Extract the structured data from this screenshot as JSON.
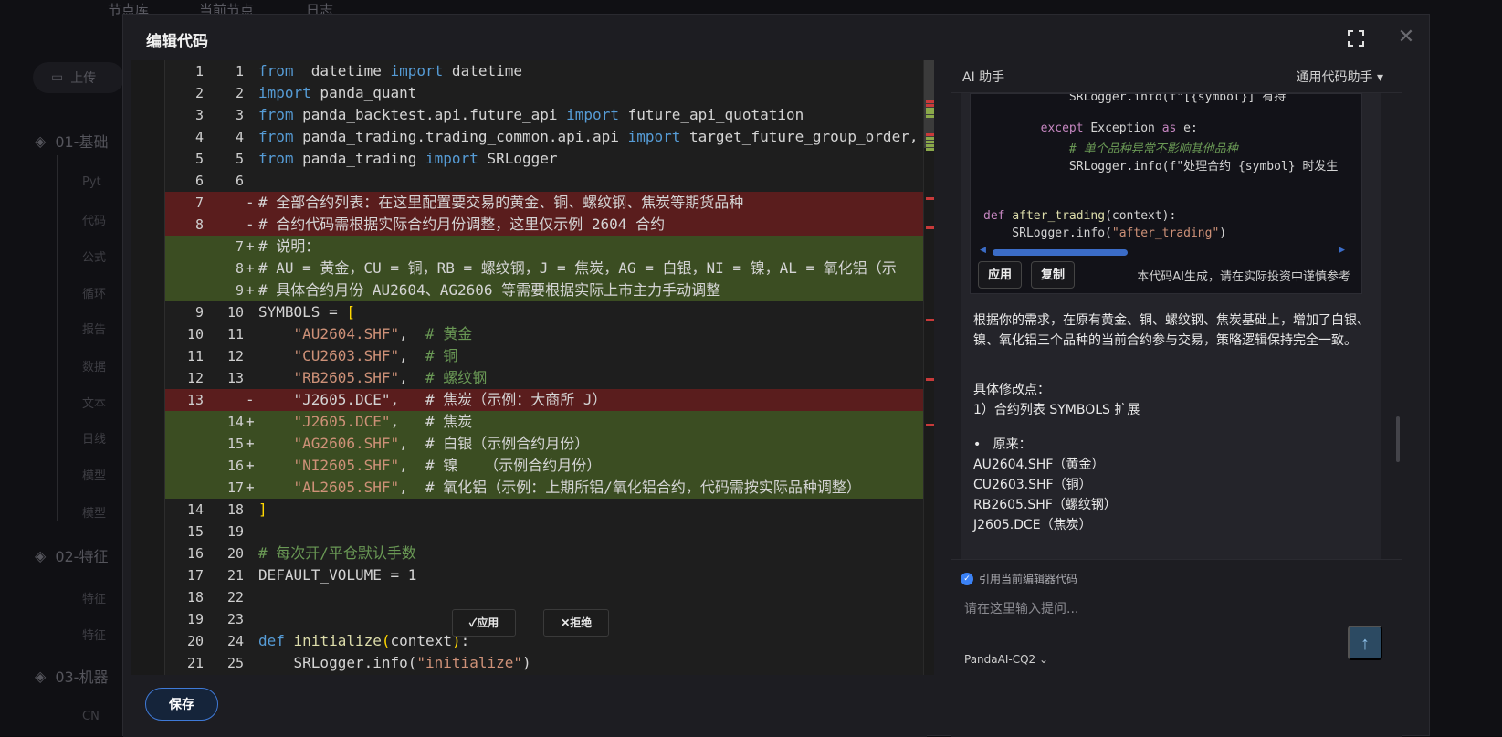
{
  "background": {
    "tabs": [
      "节点库",
      "当前节点",
      "日志"
    ],
    "upload_label": "上传",
    "groups": [
      "01-基础",
      "02-特征",
      "03-机器"
    ],
    "leaves": [
      "Pyt",
      "代码",
      "公式",
      "循环",
      "报告",
      "数据",
      "文本",
      "日线",
      "模型",
      "模型",
      "特征",
      "特征",
      "CN"
    ]
  },
  "modal": {
    "title": "编辑代码",
    "save_label": "保存"
  },
  "editor": {
    "lines": [
      {
        "o": "1",
        "n": "1",
        "s": "",
        "t": "n",
        "code": [
          [
            "kw",
            "from"
          ],
          [
            "",
            "  datetime "
          ],
          [
            "kw",
            "import"
          ],
          [
            "",
            " datetime"
          ]
        ]
      },
      {
        "o": "2",
        "n": "2",
        "s": "",
        "t": "n",
        "code": [
          [
            "kw",
            "import"
          ],
          [
            "",
            " panda_quant"
          ]
        ]
      },
      {
        "o": "3",
        "n": "3",
        "s": "",
        "t": "n",
        "code": [
          [
            "kw",
            "from"
          ],
          [
            "",
            " panda_backtest.api.future_api "
          ],
          [
            "kw",
            "import"
          ],
          [
            "",
            " future_api_quotation"
          ]
        ]
      },
      {
        "o": "4",
        "n": "4",
        "s": "",
        "t": "n",
        "code": [
          [
            "kw",
            "from"
          ],
          [
            "",
            " panda_trading.trading_common.api.api "
          ],
          [
            "kw",
            "import"
          ],
          [
            "",
            " target_future_group_order, b"
          ]
        ]
      },
      {
        "o": "5",
        "n": "5",
        "s": "",
        "t": "n",
        "code": [
          [
            "kw",
            "from"
          ],
          [
            "",
            " panda_trading "
          ],
          [
            "kw",
            "import"
          ],
          [
            "",
            " SRLogger"
          ]
        ]
      },
      {
        "o": "6",
        "n": "6",
        "s": "",
        "t": "n",
        "code": []
      },
      {
        "o": "7",
        "n": "",
        "s": "-",
        "t": "del",
        "code": [
          [
            "w",
            "# 全部合约列表：在这里配置要交易的黄金、铜、螺纹钢、焦炭等期货品种"
          ]
        ]
      },
      {
        "o": "8",
        "n": "",
        "s": "-",
        "t": "del",
        "code": [
          [
            "w",
            "# 合约代码需根据实际合约月份调整，这里仅示例 2604 合约"
          ]
        ]
      },
      {
        "o": "",
        "n": "7",
        "s": "+",
        "t": "add",
        "code": [
          [
            "g",
            "# 说明："
          ]
        ]
      },
      {
        "o": "",
        "n": "8",
        "s": "+",
        "t": "add",
        "code": [
          [
            "g",
            "# AU = 黄金，CU = 铜，RB = 螺纹钢，J = 焦炭，AG = 白银，NI = 镍，AL = 氧化铝（示"
          ]
        ]
      },
      {
        "o": "",
        "n": "9",
        "s": "+",
        "t": "add",
        "code": [
          [
            "g",
            "# 具体合约月份 AU2604、AG2606 等需要根据实际上市主力手动调整"
          ]
        ]
      },
      {
        "o": "9",
        "n": "10",
        "s": "",
        "t": "n",
        "code": [
          [
            "",
            "SYMBOLS = "
          ],
          [
            "brk",
            "["
          ]
        ]
      },
      {
        "o": "10",
        "n": "11",
        "s": "",
        "t": "n",
        "code": [
          [
            "",
            "    "
          ],
          [
            "str",
            "\"AU2604.SHF\""
          ],
          [
            "",
            ",  "
          ],
          [
            "cmt",
            "# 黄金"
          ]
        ]
      },
      {
        "o": "11",
        "n": "12",
        "s": "",
        "t": "n",
        "code": [
          [
            "",
            "    "
          ],
          [
            "str",
            "\"CU2603.SHF\""
          ],
          [
            "",
            ",  "
          ],
          [
            "cmt",
            "# 铜"
          ]
        ]
      },
      {
        "o": "12",
        "n": "13",
        "s": "",
        "t": "n",
        "code": [
          [
            "",
            "    "
          ],
          [
            "str",
            "\"RB2605.SHF\""
          ],
          [
            "",
            ",  "
          ],
          [
            "cmt",
            "# 螺纹钢"
          ]
        ]
      },
      {
        "o": "13",
        "n": "",
        "s": "-",
        "t": "del",
        "code": [
          [
            "",
            "    "
          ],
          [
            "w",
            "\"J2605.DCE\",   # 焦炭（示例：大商所 J）"
          ]
        ]
      },
      {
        "o": "",
        "n": "14",
        "s": "+",
        "t": "add",
        "code": [
          [
            "",
            "    "
          ],
          [
            "str",
            "\"J2605.DCE\""
          ],
          [
            "",
            ",   "
          ],
          [
            "g",
            "# 焦炭"
          ]
        ]
      },
      {
        "o": "",
        "n": "15",
        "s": "+",
        "t": "add",
        "code": [
          [
            "",
            "    "
          ],
          [
            "str",
            "\"AG2606.SHF\""
          ],
          [
            "",
            ",  "
          ],
          [
            "g",
            "# 白银（示例合约月份）"
          ]
        ]
      },
      {
        "o": "",
        "n": "16",
        "s": "+",
        "t": "add",
        "code": [
          [
            "",
            "    "
          ],
          [
            "str",
            "\"NI2605.SHF\""
          ],
          [
            "",
            ",  "
          ],
          [
            "g",
            "# 镍   （示例合约月份）"
          ]
        ]
      },
      {
        "o": "",
        "n": "17",
        "s": "+",
        "t": "add",
        "code": [
          [
            "",
            "    "
          ],
          [
            "str",
            "\"AL2605.SHF\""
          ],
          [
            "",
            ",  "
          ],
          [
            "g",
            "# 氧化铝（示例：上期所铝/氧化铝合约，代码需按实际品种调整）"
          ]
        ]
      },
      {
        "o": "14",
        "n": "18",
        "s": "",
        "t": "n",
        "code": [
          [
            "brk",
            "]"
          ]
        ]
      },
      {
        "o": "15",
        "n": "19",
        "s": "",
        "t": "n",
        "code": []
      },
      {
        "o": "16",
        "n": "20",
        "s": "",
        "t": "n",
        "code": [
          [
            "cmt",
            "# 每次开/平仓默认手数"
          ]
        ]
      },
      {
        "o": "17",
        "n": "21",
        "s": "",
        "t": "n",
        "code": [
          [
            "",
            "DEFAULT_VOLUME = 1"
          ]
        ]
      },
      {
        "o": "18",
        "n": "22",
        "s": "",
        "t": "n",
        "code": []
      },
      {
        "o": "19",
        "n": "23",
        "s": "",
        "t": "n",
        "code": []
      },
      {
        "o": "20",
        "n": "24",
        "s": "",
        "t": "n",
        "code": [
          [
            "kw",
            "def"
          ],
          [
            "",
            " "
          ],
          [
            "fn",
            "initialize"
          ],
          [
            "brk",
            "("
          ],
          [
            "",
            "context"
          ],
          [
            "brk",
            ")"
          ],
          [
            "",
            ":"
          ]
        ]
      },
      {
        "o": "21",
        "n": "25",
        "s": "",
        "t": "n",
        "code": [
          [
            "",
            "    SRLogger.info("
          ],
          [
            "str",
            "\"initialize\""
          ],
          [
            "",
            ")"
          ]
        ]
      }
    ],
    "apply_label": "✓应用",
    "reject_label": "✕拒绝"
  },
  "ai": {
    "title": "AI 助手",
    "mode": "通用代码助手 ▾",
    "snippet_lines": [
      [
        [
          "",
          "            SRLogger.info(f\"[{symbol}] 有持"
        ]
      ],
      [
        [
          "",
          ""
        ]
      ],
      [
        [
          "",
          "        "
        ],
        [
          "sk",
          "except"
        ],
        [
          "",
          " Exception "
        ],
        [
          "sk",
          "as"
        ],
        [
          "",
          " e:"
        ]
      ],
      [
        [
          "",
          "            "
        ],
        [
          "sc",
          "# 单个品种异常不影响其他品种"
        ]
      ],
      [
        [
          "",
          "            SRLogger.info(f\"处理合约 {symbol} 时发生"
        ]
      ],
      [
        [
          "",
          ""
        ]
      ],
      [
        [
          "",
          ""
        ]
      ],
      [
        [
          "sk",
          "def"
        ],
        [
          "",
          " "
        ],
        [
          "sf",
          "after_trading"
        ],
        [
          "",
          "(context):"
        ]
      ],
      [
        [
          "",
          "    SRLogger.info("
        ],
        [
          "ss",
          "\"after_trading\""
        ],
        [
          "",
          ")"
        ]
      ]
    ],
    "snippet_apply": "应用",
    "snippet_copy": "复制",
    "snippet_note": "本代码AI生成，请在实际投资中谨慎参考",
    "paragraph": "根据你的需求，在原有黄金、铜、螺纹钢、焦炭基础上，增加了白银、镍、氧化铝三个品种的当前合约参与交易，策略逻辑保持完全一致。",
    "changes_title": "具体修改点：",
    "change_1": "1）合约列表 SYMBOLS 扩展",
    "bullet_original": "原来：",
    "originals": [
      "AU2604.SHF（黄金）",
      "CU2603.SHF（铜）",
      "RB2605.SHF（螺纹钢）",
      "J2605.DCE（焦炭）"
    ],
    "ref_label": "引用当前编辑器代码",
    "prompt_placeholder": "请在这里输入提问...",
    "model": "PandaAI-CQ2 ⌄",
    "send_icon": "↑"
  },
  "colors": {
    "deleted_line": "#5a1d1d",
    "added_line": "#3b4d22",
    "accent": "#3f7ad8"
  }
}
